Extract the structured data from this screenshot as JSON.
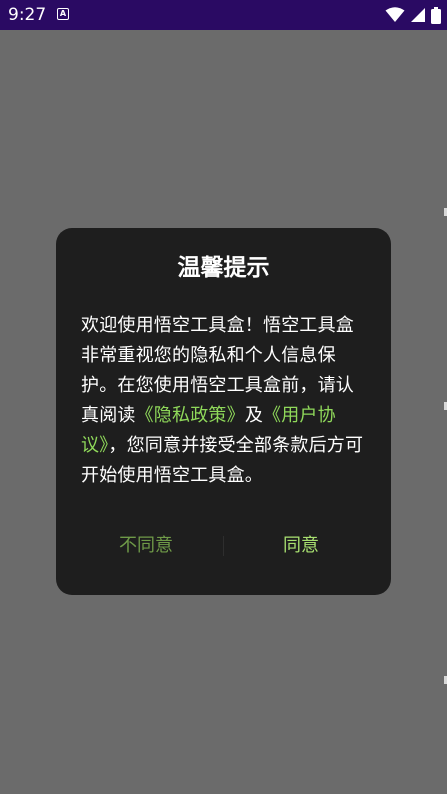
{
  "status_bar": {
    "time": "9:27",
    "app_icon_letter": "A",
    "icons": [
      "wifi-icon",
      "signal-icon",
      "battery-icon"
    ],
    "background": "#2a0a63"
  },
  "dialog": {
    "title": "温馨提示",
    "body_parts": {
      "intro": "欢迎使用悟空工具盒！悟空工具盒非常重视您的隐私和个人信息保护。在您使用悟空工具盒前，请认真阅读",
      "privacy_link": "《隐私政策》",
      "and": "及",
      "agreement_link": "《用户协议》",
      "outro": "，您同意并接受全部条款后方可开始使用悟空工具盒。"
    },
    "disagree_label": "不同意",
    "agree_label": "同意",
    "background": "#1e1e1e",
    "link_color": "#8fd85a"
  },
  "overlay_color": "#6b6b6b"
}
